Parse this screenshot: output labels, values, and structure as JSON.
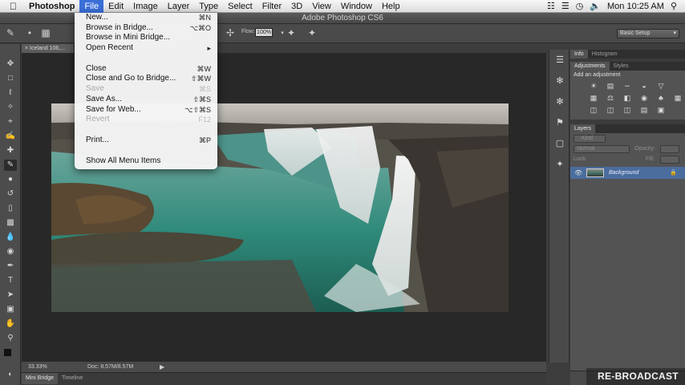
{
  "menubar": {
    "app_name": "Photoshop",
    "items": [
      "File",
      "Edit",
      "Image",
      "Layer",
      "Type",
      "Select",
      "Filter",
      "3D",
      "View",
      "Window",
      "Help"
    ],
    "active_item": "File",
    "clock": "Mon 10:25 AM"
  },
  "window": {
    "title": "Adobe Photoshop CS6"
  },
  "options_bar": {
    "flow_label": "Flow:",
    "flow_value": "100%",
    "workspace": "Basic Setup"
  },
  "document": {
    "tab_label": "Iceland 106,..."
  },
  "file_menu": {
    "groups": [
      [
        {
          "label": "New...",
          "shortcut": "⌘N",
          "enabled": true
        },
        {
          "label": "Browse in Bridge...",
          "shortcut": "⌥⌘O",
          "enabled": true
        },
        {
          "label": "Browse in Mini Bridge...",
          "shortcut": "",
          "enabled": true
        },
        {
          "label": "Open Recent",
          "shortcut": "▸",
          "enabled": true
        }
      ],
      [
        {
          "label": "Close",
          "shortcut": "⌘W",
          "enabled": true
        },
        {
          "label": "Close and Go to Bridge...",
          "shortcut": "⇧⌘W",
          "enabled": true
        },
        {
          "label": "Save",
          "shortcut": "⌘S",
          "enabled": false
        },
        {
          "label": "Save As...",
          "shortcut": "⇧⌘S",
          "enabled": true
        },
        {
          "label": "Save for Web...",
          "shortcut": "⌥⇧⌘S",
          "enabled": true
        },
        {
          "label": "Revert",
          "shortcut": "F12",
          "enabled": false
        }
      ],
      [
        {
          "label": "Print...",
          "shortcut": "⌘P",
          "enabled": true
        }
      ],
      [
        {
          "label": "Show All Menu Items",
          "shortcut": "",
          "enabled": true
        }
      ]
    ]
  },
  "status": {
    "zoom": "33.33%",
    "doc_size": "Doc: 8.57M/8.57M"
  },
  "bottom_tabs": [
    "Mini Bridge",
    "Timeline"
  ],
  "panels": {
    "top_tabs": [
      "Info",
      "Histogram"
    ],
    "adjust_tabs": [
      "Adjustments",
      "Styles"
    ],
    "adjust_title": "Add an adjustment",
    "layers_tab": "Layers",
    "kind_label": "Kind",
    "blend_mode": "Normal",
    "opacity_label": "Opacity:",
    "lock_label": "Lock:",
    "fill_label": "Fill:",
    "layer_name": "Background"
  },
  "watermark": "RE-BROADCAST"
}
